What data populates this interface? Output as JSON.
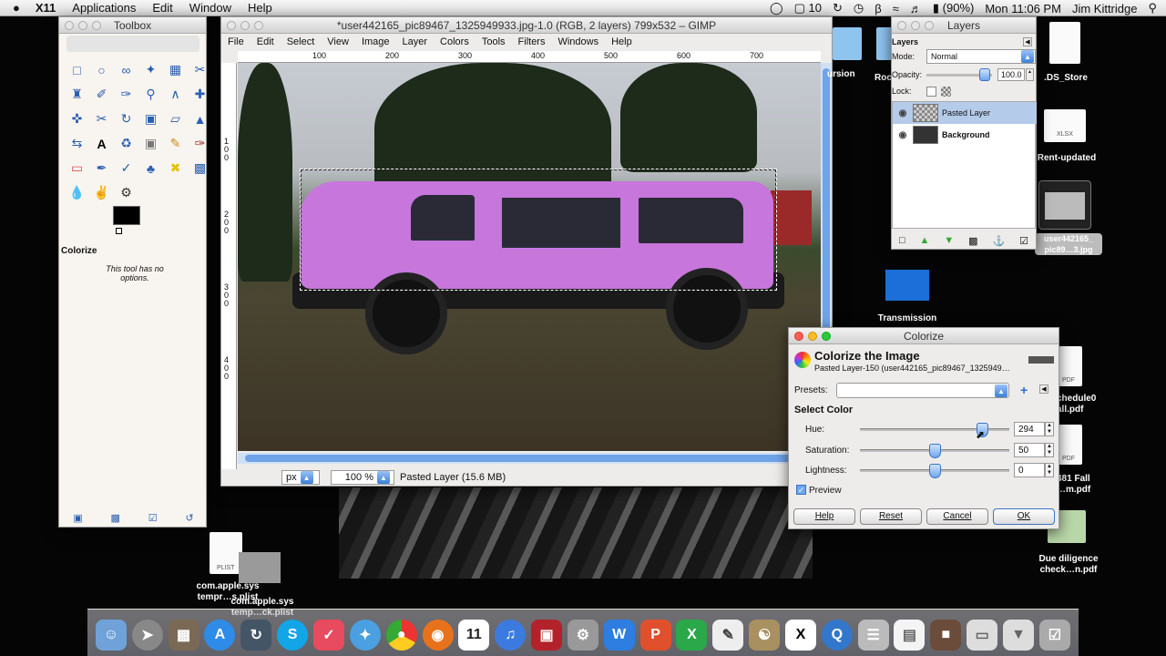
{
  "menubar": {
    "apple_icon": "apple-icon",
    "app": "X11",
    "items": [
      "Applications",
      "Edit",
      "Window",
      "Help"
    ],
    "status": {
      "volume_level": "10",
      "battery": "(90%)",
      "clock": "Mon 11:06 PM",
      "user": "Jim Kittridge"
    }
  },
  "toolbox": {
    "title": "Toolbox",
    "tool_options_title": "Colorize",
    "no_options": "This tool has no options."
  },
  "gimp": {
    "title": "*user442165_pic89467_1325949933.jpg-1.0 (RGB, 2 layers) 799x532 – GIMP",
    "menu": [
      "File",
      "Edit",
      "Select",
      "View",
      "Image",
      "Layer",
      "Colors",
      "Tools",
      "Filters",
      "Windows",
      "Help"
    ],
    "ruler_h": [
      "100",
      "200",
      "300",
      "400",
      "500",
      "600",
      "700"
    ],
    "ruler_v": [
      "1\n0\n0",
      "2\n0\n0",
      "3\n0\n0",
      "4\n0\n0"
    ],
    "unit": "px",
    "zoom": "100 %",
    "status": "Pasted Layer (15.6 MB)"
  },
  "layers": {
    "title": "Layers",
    "header": "Layers",
    "mode_label": "Mode:",
    "mode": "Normal",
    "opacity_label": "Opacity:",
    "opacity": "100.0",
    "lock_label": "Lock:",
    "items": [
      {
        "name": "Pasted Layer",
        "selected": true
      },
      {
        "name": "Background",
        "selected": false
      }
    ]
  },
  "colorize": {
    "title": "Colorize",
    "heading": "Colorize the Image",
    "subtitle": "Pasted Layer-150 (user442165_pic89467_1325949…",
    "presets_label": "Presets:",
    "select_color": "Select Color",
    "hue_label": "Hue:",
    "hue": "294",
    "saturation_label": "Saturation:",
    "saturation": "50",
    "lightness_label": "Lightness:",
    "lightness": "0",
    "hue_frac": 0.8167,
    "sat_frac": 0.5,
    "light_frac": 0.5,
    "preview_label": "Preview",
    "buttons": {
      "help": "Help",
      "reset": "Reset",
      "cancel": "Cancel",
      "ok": "OK"
    }
  },
  "desktop": {
    "ds_store": ".DS_Store",
    "xlsx_tag": "XLSX",
    "rent": "Rent-updated",
    "pic_name": "user442165_\npic89…3.jpg",
    "excursion": "ursion",
    "roc": "Roc",
    "transmission": "Transmission",
    "schedule": "chedule0\nall.pdf",
    "pdf_tag": "PDF",
    "fall": "481 Fall\n…m.pdf",
    "due": "Due diligence\ncheck…n.pdf",
    "plist_tag": "PLIST",
    "plist_name": "com.apple.sys\ntempr…s.plist",
    "plist_name2": "com.apple.sys\ntemp…ck.plist"
  },
  "dock": {
    "calendar_day": "11",
    "items": [
      "finder-icon",
      "launchpad-icon",
      "dashboard-icon",
      "app-store-icon",
      "sync-icon",
      "skype-icon",
      "pocket-icon",
      "safari-icon",
      "chrome-icon",
      "firefox-icon",
      "calendar-icon",
      "itunes-icon",
      "photo-booth-icon",
      "system-preferences-icon",
      "word-icon",
      "powerpoint-icon",
      "excel-icon",
      "textedit-icon",
      "gimp-icon",
      "x11-icon",
      "quicktime-icon",
      "script-icon",
      "document-icon",
      "folder-icon",
      "screen-icon",
      "downloads-icon",
      "trash-icon"
    ]
  }
}
